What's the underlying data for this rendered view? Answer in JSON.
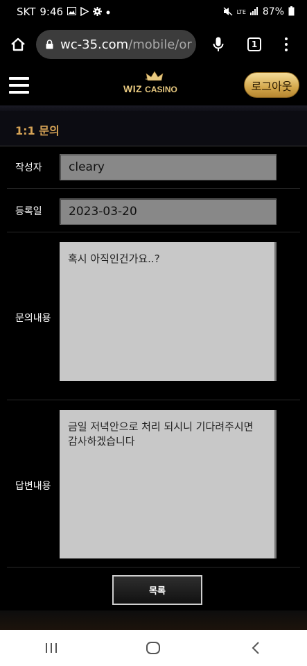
{
  "status_bar": {
    "carrier": "SKT",
    "time": "9:46",
    "network": "LTE",
    "battery": "87%"
  },
  "browser": {
    "url_host": "wc-35.com",
    "url_path": "/mobile/or",
    "tab_count": "1"
  },
  "header": {
    "logo_wiz": "WIZ",
    "logo_casino": "CASINO",
    "logout_label": "로그아웃"
  },
  "page": {
    "title": "1:1 문의"
  },
  "form": {
    "author_label": "작성자",
    "author_value": "cleary",
    "date_label": "등록일",
    "date_value": "2023-03-20",
    "inquiry_label": "문의내용",
    "inquiry_text": "혹시 아직인건가요..?",
    "answer_label": "답변내용",
    "answer_text": "금일 저녁안으로 처리 되시니 기다려주시면\n감사하겠습니다"
  },
  "list_button": "목록",
  "colors": {
    "accent_gold": "#d7a456",
    "logout_gold": "#e0b865",
    "field_gray": "#888888",
    "textarea_gray": "#c8c8c8"
  }
}
